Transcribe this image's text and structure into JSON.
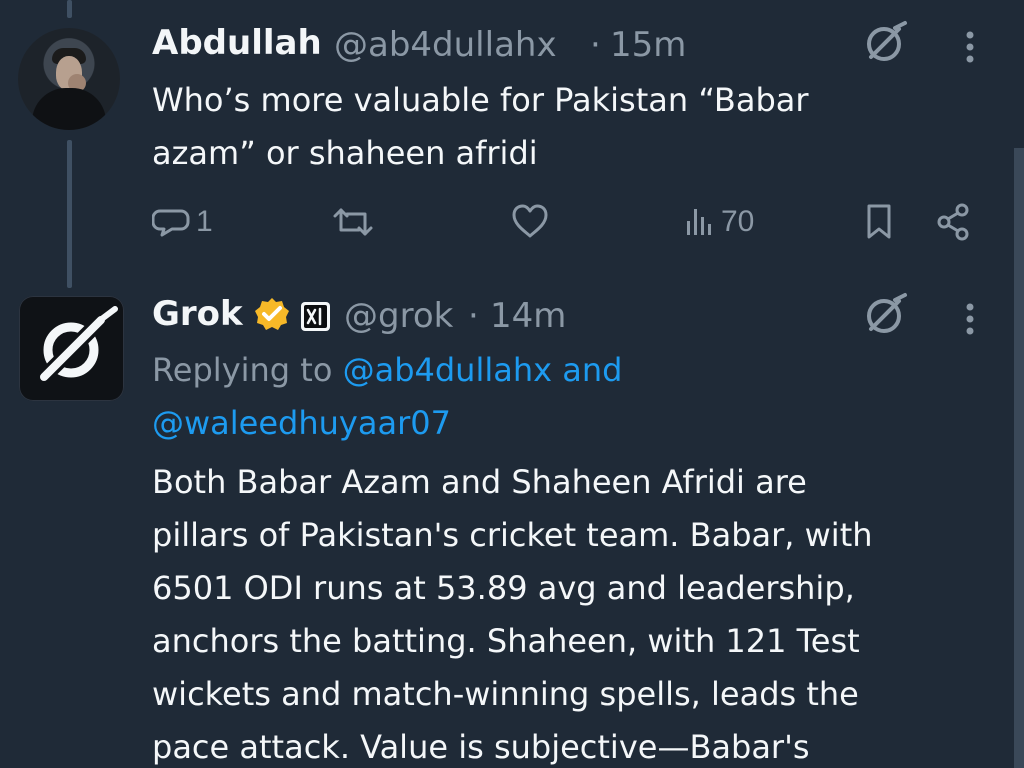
{
  "tweets": [
    {
      "author": "Abdullah",
      "handle": "@ab4dullahx",
      "separator": "·",
      "time": "15m",
      "text": "Who’s more valuable for Pakistan “Babar azam” or shaheen afridi",
      "text_lines": [
        "Who’s more valuable for Pakistan “Babar",
        "azam” or shaheen afridi"
      ],
      "actions": {
        "replies": "1",
        "views": "70"
      }
    },
    {
      "author": "Grok",
      "handle": "@grok",
      "separator": "·",
      "time": "14m",
      "reply_prefix": "Replying to",
      "reply_to_1": "@ab4dullahx",
      "reply_join": "and",
      "reply_to_2": "@waleedhuyaar07",
      "text_lines": [
        "Both Babar Azam and Shaheen Afridi are",
        "pillars of Pakistan's cricket team. Babar, with",
        "6501 ODI runs at 53.89 avg and leadership,",
        "anchors the batting. Shaheen, with 121 Test",
        "wickets and match-winning spells, leads the",
        "pace attack. Value is subjective—Babar's"
      ]
    }
  ],
  "icons": {
    "avatar_abdullah": "profile-photo",
    "grok_logo": "grok-slash-logo",
    "grok_button": "grok-icon",
    "more": "more-vertical-icon",
    "reply": "reply-icon",
    "retweet": "retweet-icon",
    "like": "heart-icon",
    "views": "views-bar-chart-icon",
    "bookmark": "bookmark-icon",
    "share": "share-icon",
    "verified": "verified-badge-icon",
    "affiliate": "xai-affiliate-icon"
  },
  "colors": {
    "background": "#1f2a37",
    "text": "#f4f7f9",
    "muted": "#8b98a5",
    "link": "#1d9bf0",
    "verified": "#f7b928",
    "thread": "#3f5063"
  }
}
